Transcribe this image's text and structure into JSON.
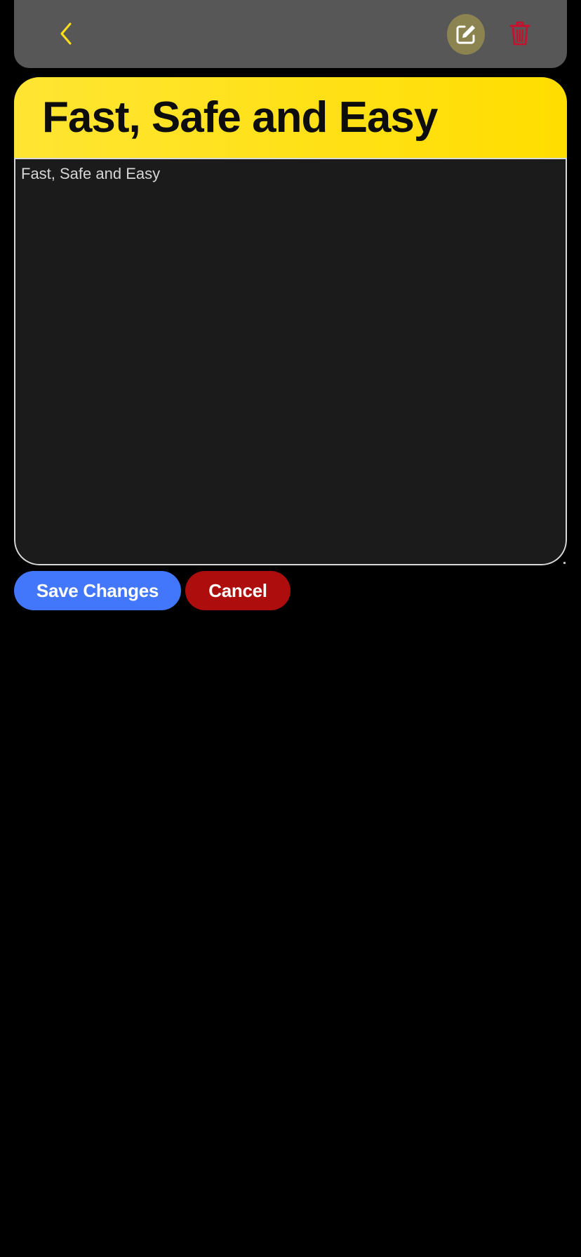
{
  "toolbar": {
    "back_icon": "chevron-left-icon",
    "edit_icon": "edit-square-icon",
    "delete_icon": "trash-icon"
  },
  "note": {
    "title": "Fast, Safe and Easy",
    "body": "Fast, Safe and Easy"
  },
  "actions": {
    "save_label": "Save Changes",
    "cancel_label": "Cancel"
  },
  "colors": {
    "background": "#000000",
    "toolbar": "#575757",
    "accent_yellow": "#ffe01a",
    "edit_bg": "#8b8350",
    "delete": "#c8102e",
    "save": "#4277fc",
    "cancel": "#ad0d0d",
    "body_bg": "#1b1b1b"
  }
}
